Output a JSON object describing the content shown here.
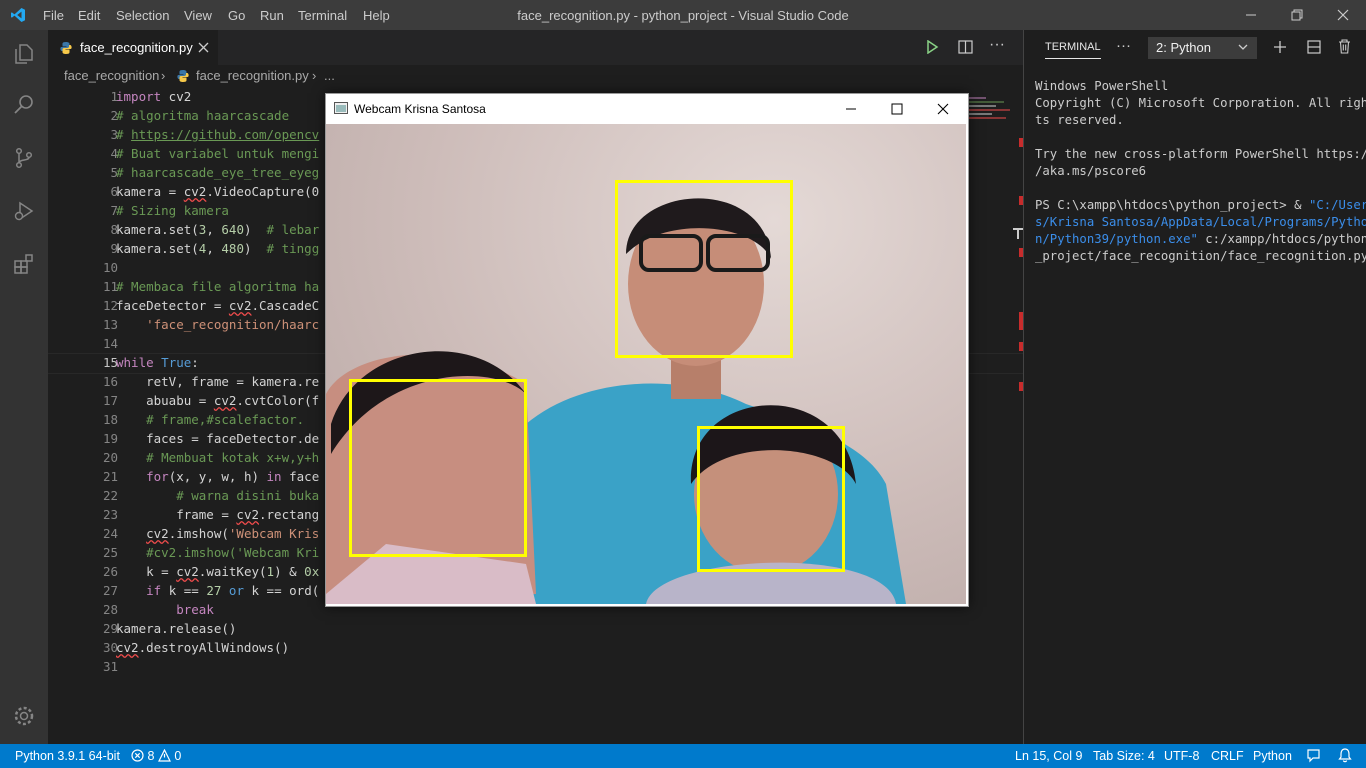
{
  "titlebar": {
    "menus": [
      "File",
      "Edit",
      "Selection",
      "View",
      "Go",
      "Run",
      "Terminal",
      "Help"
    ],
    "window_title": "face_recognition.py - python_project - Visual Studio Code"
  },
  "editor": {
    "tab_label": "face_recognition.py",
    "breadcrumb": {
      "folder": "face_recognition",
      "file": "face_recognition.py",
      "more": "..."
    },
    "line_numbers": [
      "1",
      "2",
      "3",
      "4",
      "5",
      "6",
      "7",
      "8",
      "9",
      "10",
      "11",
      "12",
      "13",
      "14",
      "15",
      "16",
      "17",
      "18",
      "19",
      "20",
      "21",
      "22",
      "23",
      "24",
      "25",
      "26",
      "27",
      "28",
      "29",
      "30",
      "31"
    ],
    "current_line": "15"
  },
  "terminal": {
    "tab_label": "TERMINAL",
    "more": "···",
    "shell_select": "2: Python",
    "lines": [
      "Windows PowerShell",
      "Copyright (C) Microsoft Corporation. All righ",
      "ts reserved.",
      "",
      "Try the new cross-platform PowerShell https:/",
      "/aka.ms/pscore6",
      ""
    ],
    "prompt": "PS C:\\xampp\\htdocs\\python_project> & ",
    "exe_1": "\"C:/User",
    "exe_2": "s/Krisna Santosa/AppData/Local/Programs/Pytho",
    "exe_3": "n/Python39/python.exe\"",
    "arg_1": " c:/xampp/htdocs/python",
    "arg_2": "_project/face_recognition/face_recognition.py"
  },
  "popup": {
    "title": "Webcam Krisna Santosa"
  },
  "statusbar": {
    "interpreter": "Python 3.9.1 64-bit",
    "errors": "8",
    "warnings": "0",
    "position": "Ln 15, Col 9",
    "tab_size": "Tab Size: 4",
    "encoding": "UTF-8",
    "eol": "CRLF",
    "language": "Python"
  }
}
